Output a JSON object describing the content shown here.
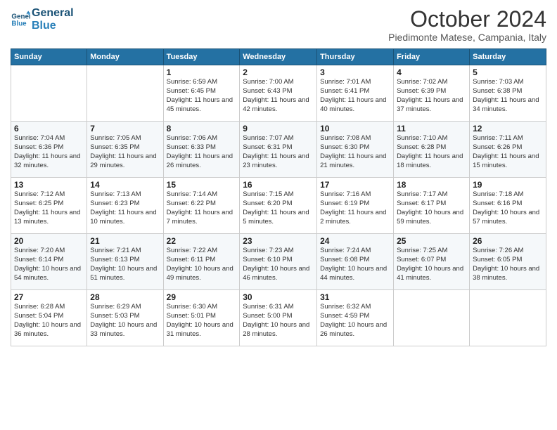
{
  "header": {
    "logo_general": "General",
    "logo_blue": "Blue",
    "month_title": "October 2024",
    "location": "Piedimonte Matese, Campania, Italy"
  },
  "weekdays": [
    "Sunday",
    "Monday",
    "Tuesday",
    "Wednesday",
    "Thursday",
    "Friday",
    "Saturday"
  ],
  "weeks": [
    [
      {
        "day": "",
        "info": ""
      },
      {
        "day": "",
        "info": ""
      },
      {
        "day": "1",
        "info": "Sunrise: 6:59 AM\nSunset: 6:45 PM\nDaylight: 11 hours and 45 minutes."
      },
      {
        "day": "2",
        "info": "Sunrise: 7:00 AM\nSunset: 6:43 PM\nDaylight: 11 hours and 42 minutes."
      },
      {
        "day": "3",
        "info": "Sunrise: 7:01 AM\nSunset: 6:41 PM\nDaylight: 11 hours and 40 minutes."
      },
      {
        "day": "4",
        "info": "Sunrise: 7:02 AM\nSunset: 6:39 PM\nDaylight: 11 hours and 37 minutes."
      },
      {
        "day": "5",
        "info": "Sunrise: 7:03 AM\nSunset: 6:38 PM\nDaylight: 11 hours and 34 minutes."
      }
    ],
    [
      {
        "day": "6",
        "info": "Sunrise: 7:04 AM\nSunset: 6:36 PM\nDaylight: 11 hours and 32 minutes."
      },
      {
        "day": "7",
        "info": "Sunrise: 7:05 AM\nSunset: 6:35 PM\nDaylight: 11 hours and 29 minutes."
      },
      {
        "day": "8",
        "info": "Sunrise: 7:06 AM\nSunset: 6:33 PM\nDaylight: 11 hours and 26 minutes."
      },
      {
        "day": "9",
        "info": "Sunrise: 7:07 AM\nSunset: 6:31 PM\nDaylight: 11 hours and 23 minutes."
      },
      {
        "day": "10",
        "info": "Sunrise: 7:08 AM\nSunset: 6:30 PM\nDaylight: 11 hours and 21 minutes."
      },
      {
        "day": "11",
        "info": "Sunrise: 7:10 AM\nSunset: 6:28 PM\nDaylight: 11 hours and 18 minutes."
      },
      {
        "day": "12",
        "info": "Sunrise: 7:11 AM\nSunset: 6:26 PM\nDaylight: 11 hours and 15 minutes."
      }
    ],
    [
      {
        "day": "13",
        "info": "Sunrise: 7:12 AM\nSunset: 6:25 PM\nDaylight: 11 hours and 13 minutes."
      },
      {
        "day": "14",
        "info": "Sunrise: 7:13 AM\nSunset: 6:23 PM\nDaylight: 11 hours and 10 minutes."
      },
      {
        "day": "15",
        "info": "Sunrise: 7:14 AM\nSunset: 6:22 PM\nDaylight: 11 hours and 7 minutes."
      },
      {
        "day": "16",
        "info": "Sunrise: 7:15 AM\nSunset: 6:20 PM\nDaylight: 11 hours and 5 minutes."
      },
      {
        "day": "17",
        "info": "Sunrise: 7:16 AM\nSunset: 6:19 PM\nDaylight: 11 hours and 2 minutes."
      },
      {
        "day": "18",
        "info": "Sunrise: 7:17 AM\nSunset: 6:17 PM\nDaylight: 10 hours and 59 minutes."
      },
      {
        "day": "19",
        "info": "Sunrise: 7:18 AM\nSunset: 6:16 PM\nDaylight: 10 hours and 57 minutes."
      }
    ],
    [
      {
        "day": "20",
        "info": "Sunrise: 7:20 AM\nSunset: 6:14 PM\nDaylight: 10 hours and 54 minutes."
      },
      {
        "day": "21",
        "info": "Sunrise: 7:21 AM\nSunset: 6:13 PM\nDaylight: 10 hours and 51 minutes."
      },
      {
        "day": "22",
        "info": "Sunrise: 7:22 AM\nSunset: 6:11 PM\nDaylight: 10 hours and 49 minutes."
      },
      {
        "day": "23",
        "info": "Sunrise: 7:23 AM\nSunset: 6:10 PM\nDaylight: 10 hours and 46 minutes."
      },
      {
        "day": "24",
        "info": "Sunrise: 7:24 AM\nSunset: 6:08 PM\nDaylight: 10 hours and 44 minutes."
      },
      {
        "day": "25",
        "info": "Sunrise: 7:25 AM\nSunset: 6:07 PM\nDaylight: 10 hours and 41 minutes."
      },
      {
        "day": "26",
        "info": "Sunrise: 7:26 AM\nSunset: 6:05 PM\nDaylight: 10 hours and 38 minutes."
      }
    ],
    [
      {
        "day": "27",
        "info": "Sunrise: 6:28 AM\nSunset: 5:04 PM\nDaylight: 10 hours and 36 minutes."
      },
      {
        "day": "28",
        "info": "Sunrise: 6:29 AM\nSunset: 5:03 PM\nDaylight: 10 hours and 33 minutes."
      },
      {
        "day": "29",
        "info": "Sunrise: 6:30 AM\nSunset: 5:01 PM\nDaylight: 10 hours and 31 minutes."
      },
      {
        "day": "30",
        "info": "Sunrise: 6:31 AM\nSunset: 5:00 PM\nDaylight: 10 hours and 28 minutes."
      },
      {
        "day": "31",
        "info": "Sunrise: 6:32 AM\nSunset: 4:59 PM\nDaylight: 10 hours and 26 minutes."
      },
      {
        "day": "",
        "info": ""
      },
      {
        "day": "",
        "info": ""
      }
    ]
  ]
}
